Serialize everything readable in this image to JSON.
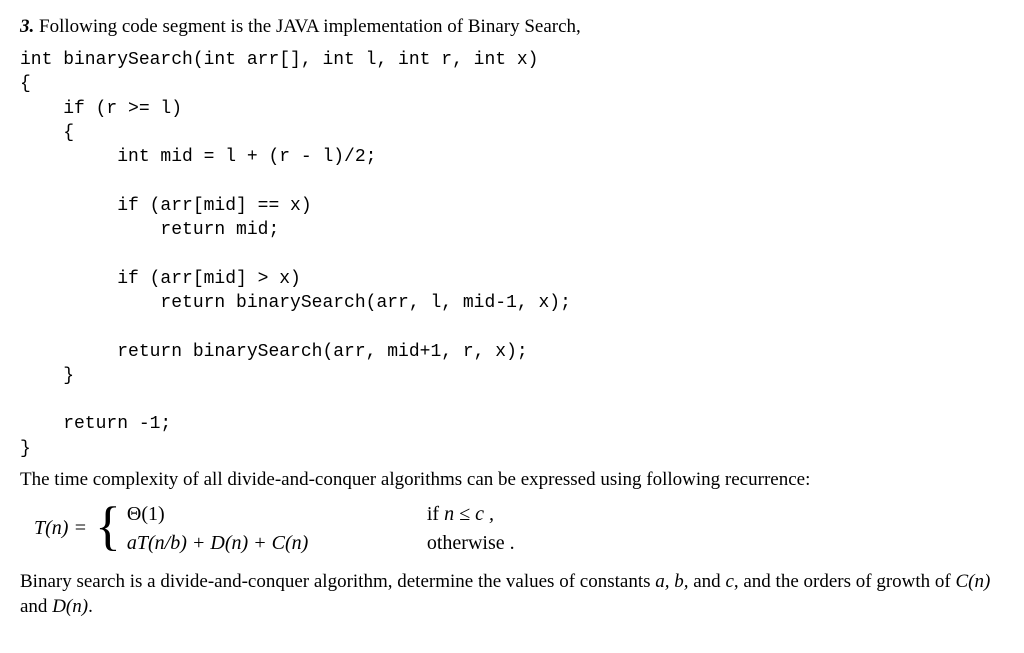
{
  "question": {
    "number": "3.",
    "header": "Following code segment is the JAVA implementation of Binary Search,"
  },
  "code": "int binarySearch(int arr[], int l, int r, int x)\n{\n    if (r >= l)\n    {\n         int mid = l + (r - l)/2;\n\n         if (arr[mid] == x)\n             return mid;\n\n         if (arr[mid] > x)\n             return binarySearch(arr, l, mid-1, x);\n\n         return binarySearch(arr, mid+1, r, x);\n    }\n\n    return -1;\n}",
  "explanation": {
    "intro": "The time complexity of all divide-and-conquer algorithms can be expressed using following recurrence:"
  },
  "recurrence": {
    "lhs": "T(n) =",
    "case1_left": "Θ(1)",
    "case1_right_if": "if ",
    "case1_right_cond": "n ≤ c ,",
    "case2_left": "aT(n/b) + D(n) + C(n)",
    "case2_right": "otherwise ."
  },
  "final": {
    "part1": "Binary search is a divide-and-conquer algorithm, determine the values of constants ",
    "vars": "a, b,",
    "and": " and ",
    "varc": "c",
    "part2": ", and the orders of growth of ",
    "cn": "C(n)",
    "and2": " and ",
    "dn": "D(n)",
    "period": "."
  }
}
